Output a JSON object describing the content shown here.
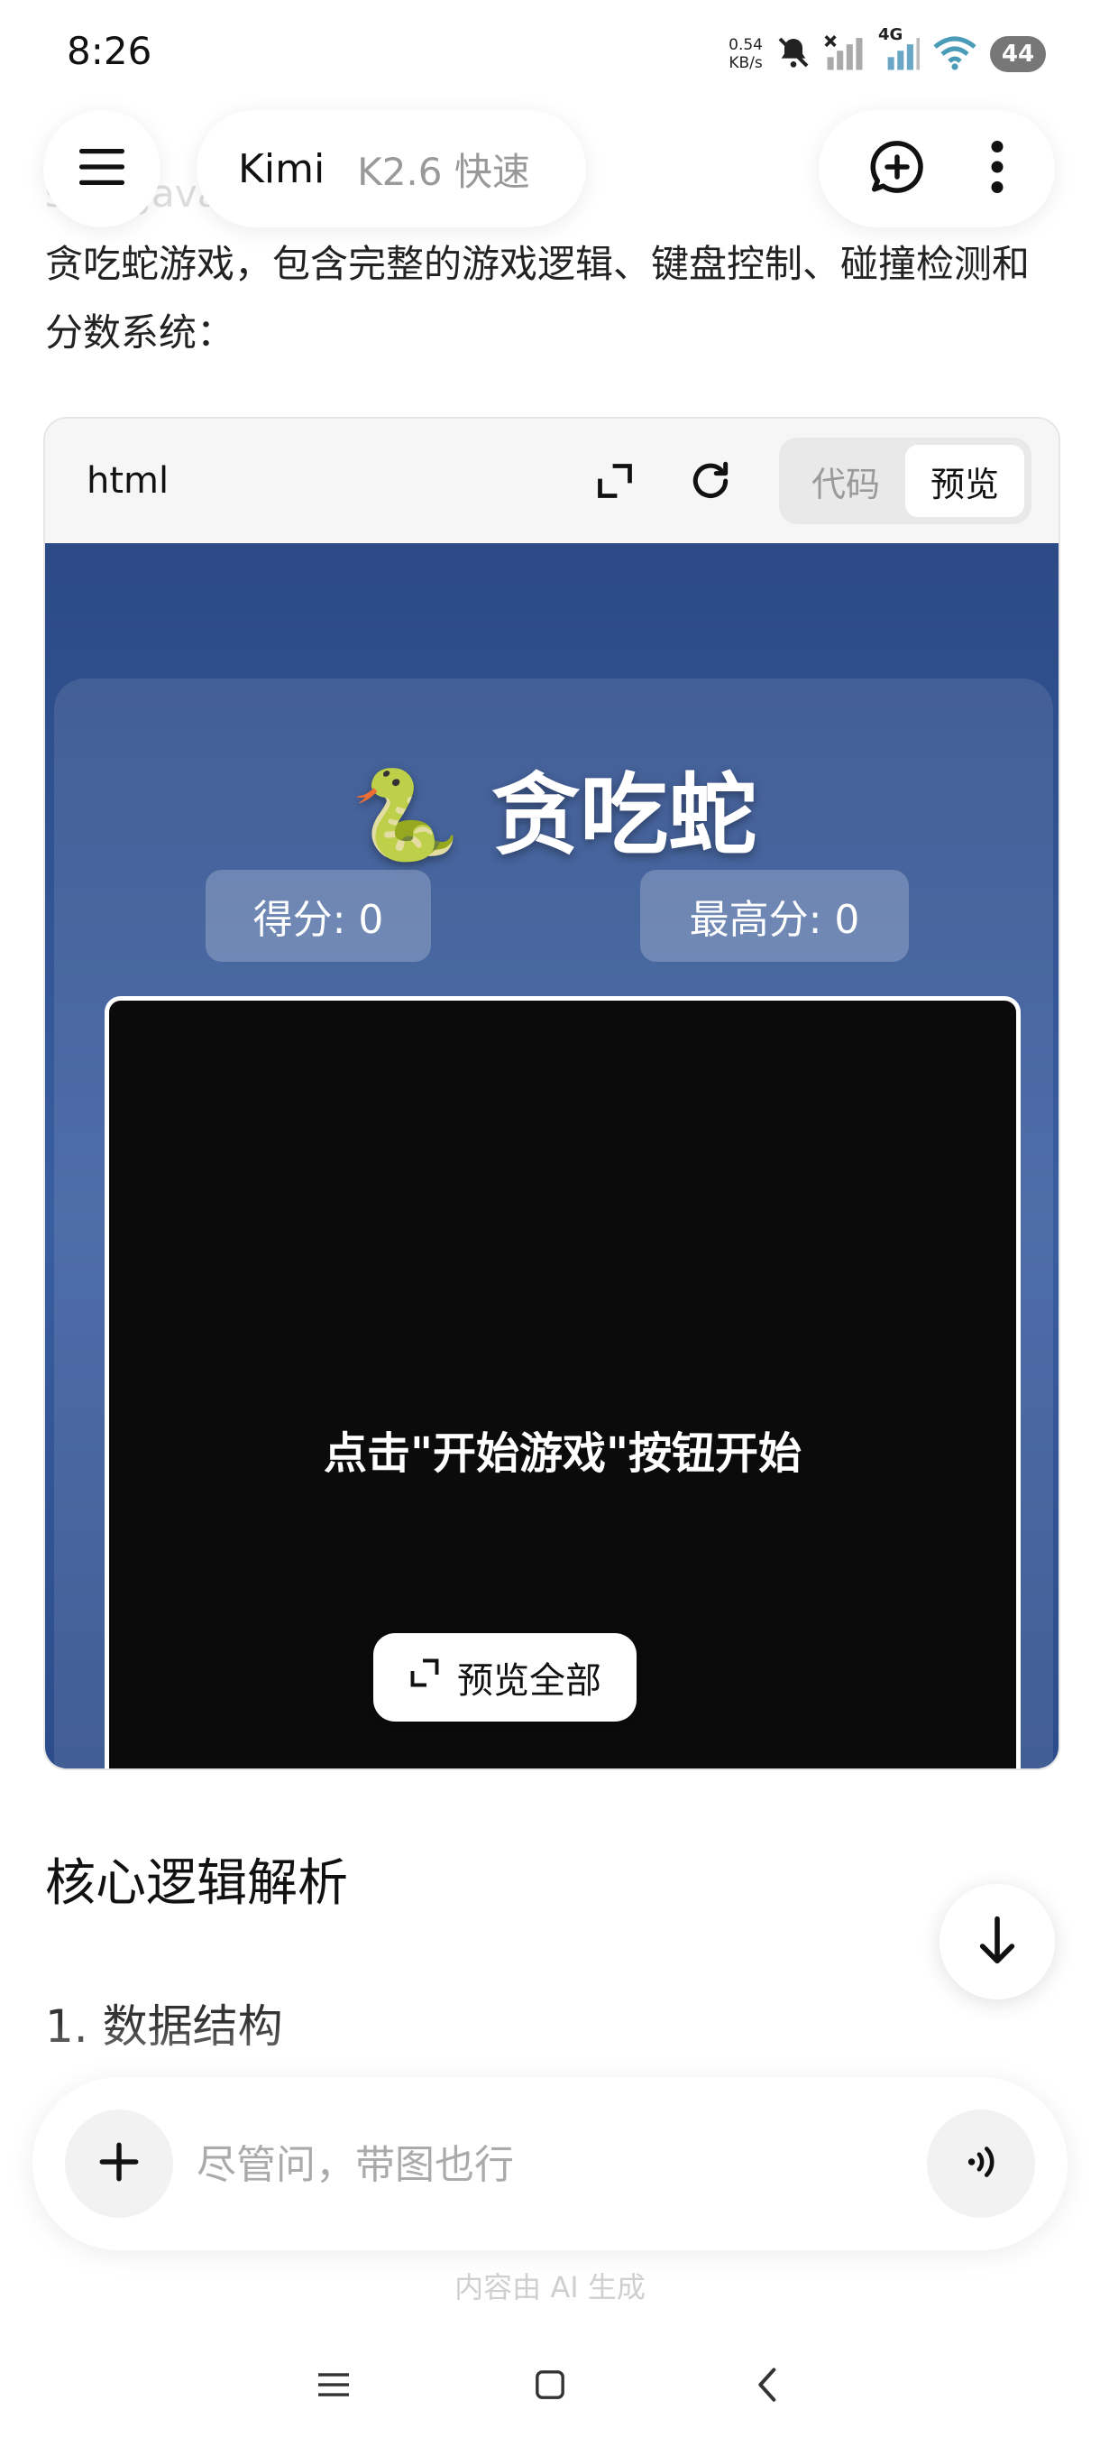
{
  "status": {
    "time": "8:26",
    "netspeed_value": "0.54",
    "netspeed_unit": "KB/s",
    "network": "4G",
    "battery": "44",
    "icons": [
      "bell-off-icon",
      "signal-off-icon",
      "signal-4g-icon",
      "wifi-icon",
      "battery-icon"
    ]
  },
  "header": {
    "app_name": "Kimi",
    "model": "K2.6 快速",
    "icons": [
      "menu-icon",
      "new-chat-icon",
      "more-icon"
    ]
  },
  "message": {
    "intro_fade": "ss + JavaScri",
    "intro": "贪吃蛇游戏，包含完整的游戏逻辑、键盘控制、碰撞检测和分数系统："
  },
  "code_card": {
    "language": "html",
    "tabs": [
      {
        "label": "代码",
        "active": false
      },
      {
        "label": "预览",
        "active": true
      }
    ],
    "icons": [
      "expand-icon",
      "refresh-icon"
    ],
    "preview": {
      "title_emoji": "🐍",
      "title": "贪吃蛇",
      "score": "得分: 0",
      "high_score": "最高分: 0",
      "board_message": "点击\"开始游戏\"按钮开始",
      "preview_all": "预览全部"
    }
  },
  "content": {
    "section_title": "核心逻辑解析",
    "subsection": "1. 数据结构"
  },
  "input": {
    "placeholder": "尽管问，带图也行",
    "value": "",
    "disclaimer": "内容由 AI 生成"
  },
  "colors": {
    "accent": "#2b4a86",
    "board": "#0b0b0b"
  }
}
